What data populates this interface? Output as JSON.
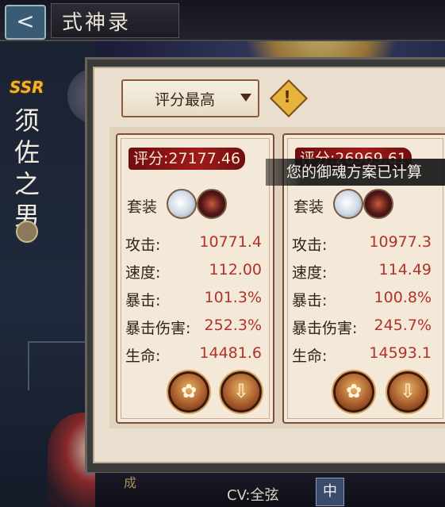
{
  "header": {
    "back_glyph": "<",
    "title": "式神录"
  },
  "shikigami": {
    "rarity": "SSR",
    "name_chars": [
      "须",
      "佐",
      "之",
      "男"
    ]
  },
  "sort": {
    "selected": "评分最高"
  },
  "info_glyph": "!",
  "toast": "您的御魂方案已计算",
  "cards": [
    {
      "score": "评分:27177.46",
      "set_label": "套装",
      "set_icons": [
        "white-hair-mask-icon",
        "dark-armor-mask-icon"
      ],
      "stats": [
        {
          "name": "攻击:",
          "value": "10771.4"
        },
        {
          "name": "速度:",
          "value": "112.00"
        },
        {
          "name": "暴击:",
          "value": "101.3%"
        },
        {
          "name": "暴击伤害:",
          "value": "252.3%"
        },
        {
          "name": "生命:",
          "value": "14481.6"
        }
      ]
    },
    {
      "score": "评分:26969.61",
      "set_label": "套装",
      "set_icons": [
        "white-hair-mask-icon",
        "dark-armor-mask-icon"
      ],
      "stats": [
        {
          "name": "攻击:",
          "value": "10977.3"
        },
        {
          "name": "速度:",
          "value": "114.49"
        },
        {
          "name": "暴击:",
          "value": "100.8%"
        },
        {
          "name": "暴击伤害:",
          "value": "245.7%"
        },
        {
          "name": "生命:",
          "value": "14593.1"
        }
      ]
    }
  ],
  "footer": {
    "cv": "CV:全弦",
    "lang": "中",
    "side_char": "成"
  }
}
